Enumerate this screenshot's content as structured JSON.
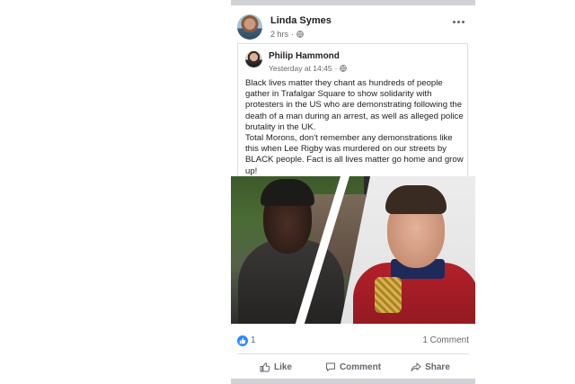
{
  "post": {
    "author": "Linda Symes",
    "time": "2 hrs",
    "privacy_icon": "globe-icon"
  },
  "shared_post": {
    "author": "Philip Hammond",
    "time": "Yesterday at 14:45",
    "privacy_icon": "globe-icon",
    "paragraphs": [
      "Black lives matter they chant as hundreds of people gather in Trafalgar Square to show solidarity with protesters in the US who are demonstrating following the death of a man during an arrest, as well as alleged police brutality in the UK.",
      "Total Morons, don't remember any demonstrations like this when Lee Rigby was murdered on our streets by BLACK people. Fact is all lives matter go home and grow up!"
    ]
  },
  "engagement": {
    "like_count": "1",
    "comment_count": "1 Comment"
  },
  "actions": {
    "like": "Like",
    "comment": "Comment",
    "share": "Share"
  },
  "colors": {
    "like_blue": "#2d88ff",
    "meta_gray": "#65676b",
    "text": "#1c1e21"
  }
}
